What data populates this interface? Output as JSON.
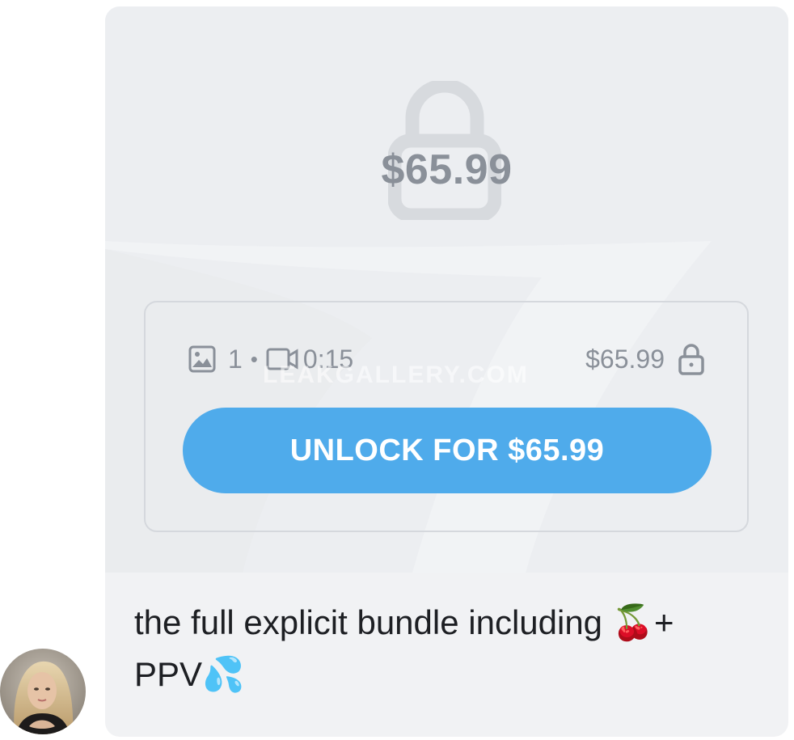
{
  "message": {
    "locked_price": "$65.99",
    "media": {
      "photo_count": "1",
      "separator": "•",
      "video_duration": "0:15",
      "price": "$65.99"
    },
    "watermark": "LEAKGALLERY.COM",
    "unlock_button_label": "UNLOCK FOR $65.99",
    "caption_text": "the full explicit bundle including",
    "caption_plus": "+",
    "caption_line2": "PPV",
    "emoji": {
      "cherries": "🍒",
      "sweat": "💦"
    }
  },
  "colors": {
    "bubble_bg": "#f1f2f4",
    "media_bg": "#eceef1",
    "muted": "#8a9099",
    "accent": "#4fabeb",
    "text": "#1d1f23"
  },
  "icons": [
    "lock-icon",
    "image-icon",
    "video-icon",
    "padlock-icon",
    "avatar"
  ]
}
